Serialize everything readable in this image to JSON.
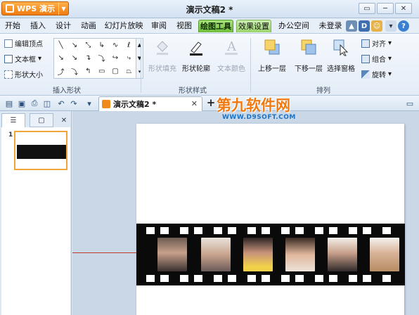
{
  "app": {
    "button_label": "WPS 演示",
    "window_title": "演示文稿2 *"
  },
  "window_controls": [
    "▭",
    "─",
    "□",
    "✕"
  ],
  "menu": {
    "items": [
      {
        "label": "开始"
      },
      {
        "label": "插入"
      },
      {
        "label": "设计"
      },
      {
        "label": "动画"
      },
      {
        "label": "幻灯片放映"
      },
      {
        "label": "审阅"
      },
      {
        "label": "视图"
      },
      {
        "label": "绘图工具"
      },
      {
        "label": "效果设置"
      },
      {
        "label": "办公空间"
      }
    ],
    "login": "未登录",
    "icons": [
      "up-icon",
      "D-icon",
      "user-icon",
      "help-icon"
    ]
  },
  "ribbon": {
    "insert_shapes": {
      "edit_points": "编辑顶点",
      "text_box": "文本框",
      "shape_size": "形状大小",
      "label": "插入形状"
    },
    "shape_style": {
      "fill": "形状填充",
      "outline": "形状轮廓",
      "text_color": "文本颜色",
      "label": "形状样式"
    },
    "arrange": {
      "bring_forward": "上移一层",
      "send_backward": "下移一层",
      "selection_pane": "选择窗格",
      "align": "对齐",
      "group": "组合",
      "rotate": "旋转",
      "label": "排列"
    }
  },
  "document_tab": {
    "title": "演示文稿2 *",
    "close": "✕",
    "new": "+"
  },
  "slides_pane": {
    "slide_number": "1",
    "close": "✕"
  },
  "watermark": {
    "main": "第九软件网",
    "sub": "WWW.D9SOFT.COM"
  },
  "colors": {
    "accent_orange": "#f07c10",
    "active_tab_green": "#6fbe3d",
    "film_black": "#0a0a0a",
    "guide_red": "#c0392b"
  }
}
